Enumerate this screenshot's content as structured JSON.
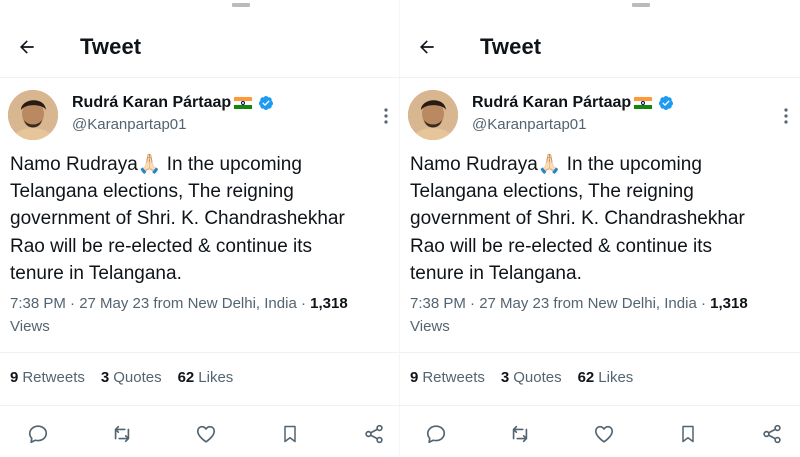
{
  "header": {
    "title": "Tweet"
  },
  "tweet": {
    "author_name": "Rudrá Karan Pártaap",
    "author_handle": "@Karanpartap01",
    "text_lines": [
      "Namo Rudraya🙏🏻 In the upcoming",
      "Telangana elections, The reigning",
      "government of Shri. K. Chandrashekhar",
      "Rao will be re-elected & continue its",
      "tenure in Telangana."
    ],
    "timestamp": "7:38 PM · 27 May 23 from New Delhi, India · ",
    "views_count": "1,318",
    "views_label": "Views",
    "retweets_count": "9",
    "retweets_label": "Retweets",
    "quotes_count": "3",
    "quotes_label": "Quotes",
    "likes_count": "62",
    "likes_label": "Likes"
  },
  "icons": {
    "back": "arrow-left-icon",
    "more": "more-vertical-icon",
    "verified": "verified-badge-icon",
    "flag": "india-flag-icon",
    "reply": "reply-icon",
    "retweet": "retweet-icon",
    "like": "heart-icon",
    "bookmark": "bookmark-icon",
    "share": "share-icon"
  },
  "colors": {
    "verified": "#1d9bf0",
    "text": "#0f1419",
    "muted": "#536471"
  }
}
